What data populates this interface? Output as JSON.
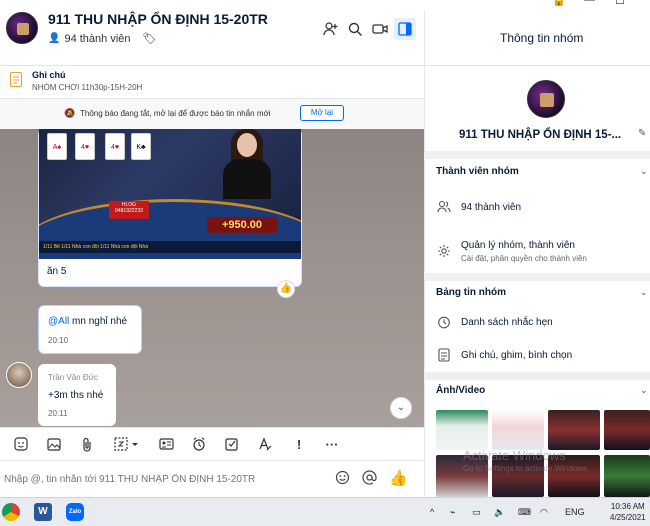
{
  "header": {
    "title": "911 THU NHẬP ỔN ĐỊNH 15-20TR",
    "member_count": "94 thành viên"
  },
  "note": {
    "title": "Ghi chú",
    "content": "NHÓM CHƠI 11h30p-15H-20H"
  },
  "notification": {
    "text": "Thông báo đang tắt, mở lại để được báo tin nhắn mới",
    "button": "Mở lại"
  },
  "messages": [
    {
      "type": "image",
      "caption": "ăn 5",
      "game": {
        "score": "+950.00",
        "strip": "1/11  Bê   1/11  Nhà con đội   1/11  Nhà con đội   Nhà"
      }
    },
    {
      "type": "text",
      "mention": "@All",
      "text": "mn nghỉ nhé",
      "time": "20:10"
    },
    {
      "type": "text",
      "sender": "Trần Văn Đức",
      "text": "+3m ths nhé",
      "time": "20:11"
    }
  ],
  "input": {
    "placeholder": "Nhập @, tin nhắn tới 911 THU NHẬP ỔN ĐỊNH 15-20TR"
  },
  "right_panel": {
    "title": "Thông tin nhóm",
    "group_name": "911 THU NHẬP ỔN ĐỊNH 15-...",
    "sections": {
      "members": {
        "title": "Thành viên nhóm",
        "count": "94 thành viên",
        "manage": "Quản lý nhóm, thành viên",
        "manage_sub": "Cài đặt, phân quyền cho thành viên"
      },
      "board": {
        "title": "Bảng tin nhóm",
        "reminders": "Danh sách nhắc hẹn",
        "notes": "Ghi chú, ghim, bình chọn"
      },
      "media": {
        "title": "Ảnh/Video"
      }
    },
    "watermark": {
      "line1": "Activate Windows",
      "line2": "Go to Settings to activate Windows."
    }
  },
  "taskbar": {
    "lang": "ENG",
    "time": "10:36 AM",
    "date": "4/25/2021"
  },
  "icons": {
    "header": [
      "add-member-icon",
      "search-icon",
      "video-call-icon",
      "info-panel-icon"
    ],
    "toolbar": [
      "sticker-icon",
      "image-icon",
      "attach-icon",
      "screenshot-icon",
      "card-icon",
      "reminder-icon",
      "task-icon",
      "format-icon",
      "important-icon",
      "more-icon"
    ]
  },
  "colors": {
    "accent": "#0068ff",
    "chat_bg": "#9a908d"
  }
}
